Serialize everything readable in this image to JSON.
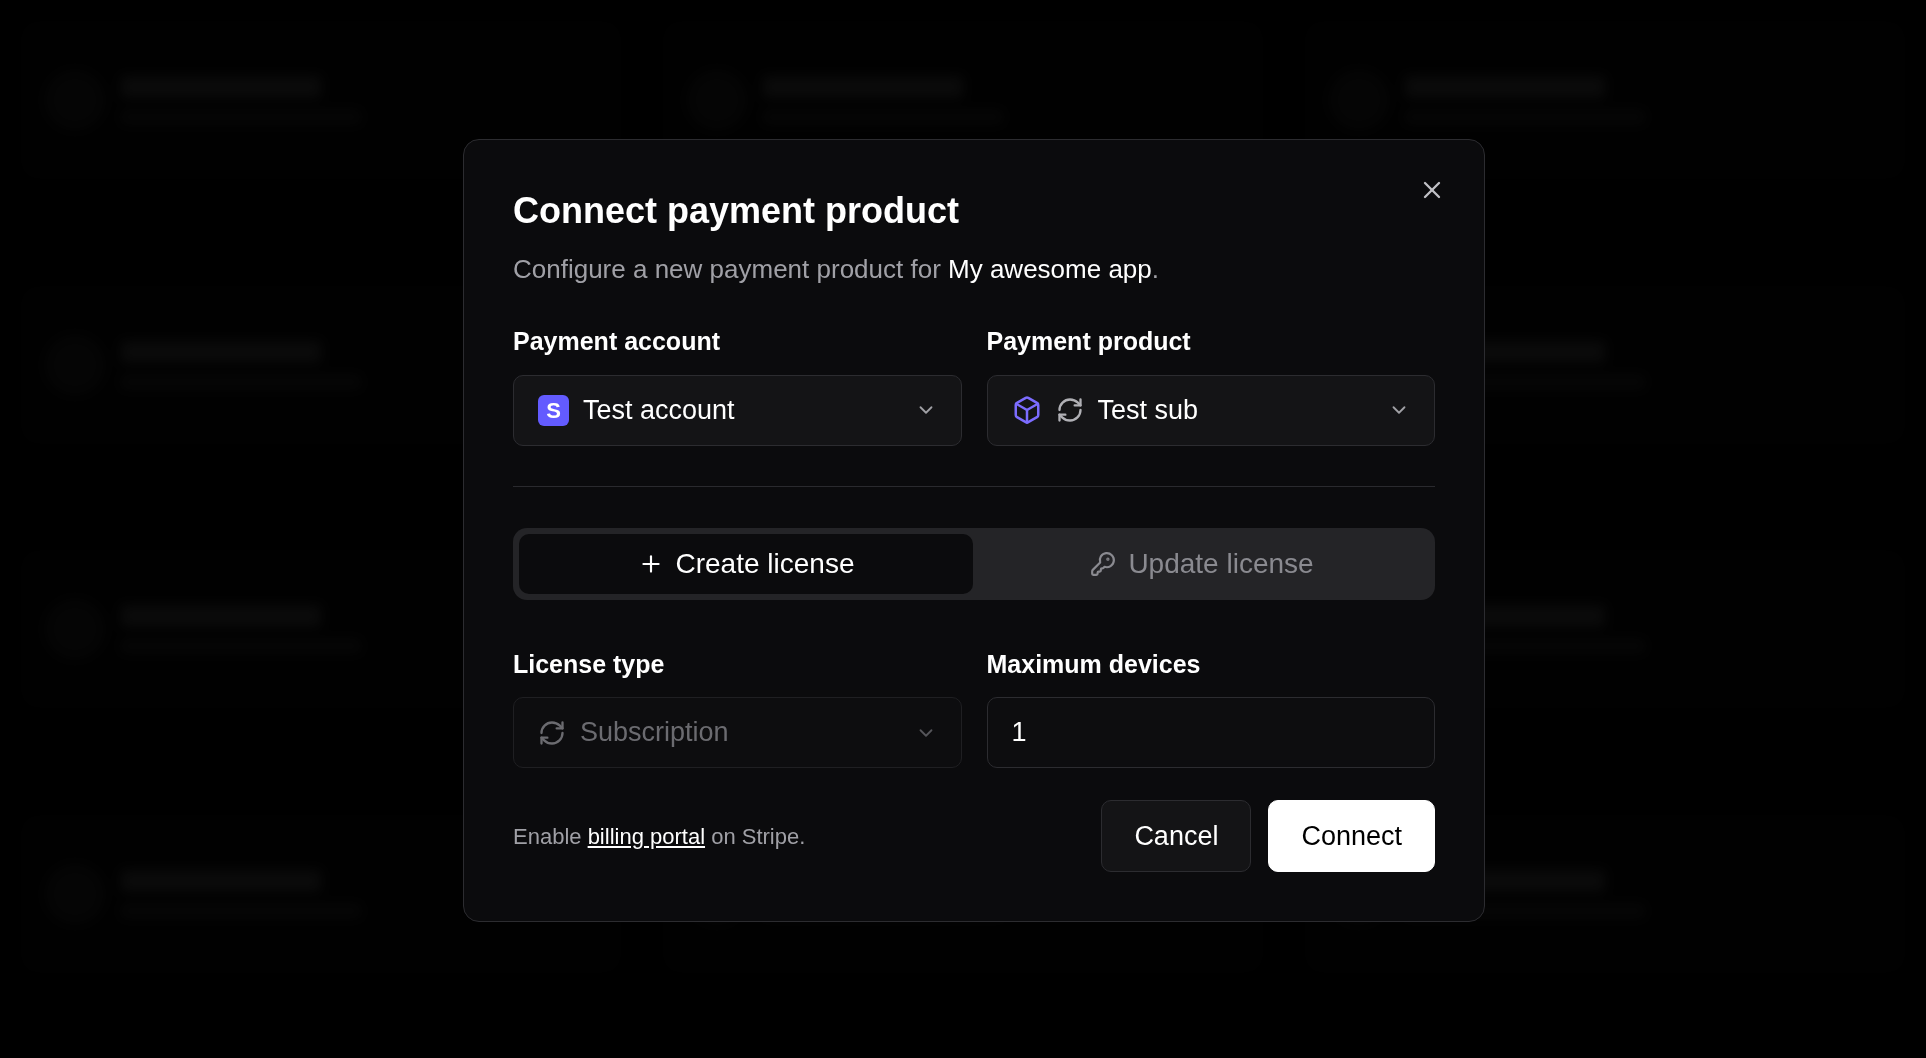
{
  "dialog": {
    "title": "Connect payment product",
    "description": {
      "prefix": "Configure a new payment product for ",
      "highlight": "My awesome app",
      "suffix": "."
    },
    "account": {
      "label": "Payment account",
      "value": "Test account",
      "badge": "S"
    },
    "product": {
      "label": "Payment product",
      "value": "Test sub"
    },
    "tabs": [
      {
        "label": "Create license",
        "selected": true,
        "kind": "plus"
      },
      {
        "label": "Update license",
        "selected": false,
        "kind": "key"
      }
    ],
    "license_type": {
      "label": "License type",
      "value": "Subscription",
      "disabled": true
    },
    "max_devices": {
      "label": "Maximum devices",
      "value": "1"
    },
    "footer": {
      "prefix": "Enable ",
      "link": "billing portal",
      "suffix": " on Stripe."
    },
    "buttons": [
      {
        "label": "Cancel",
        "kind": "secondary"
      },
      {
        "label": "Connect",
        "kind": "primary"
      }
    ]
  }
}
